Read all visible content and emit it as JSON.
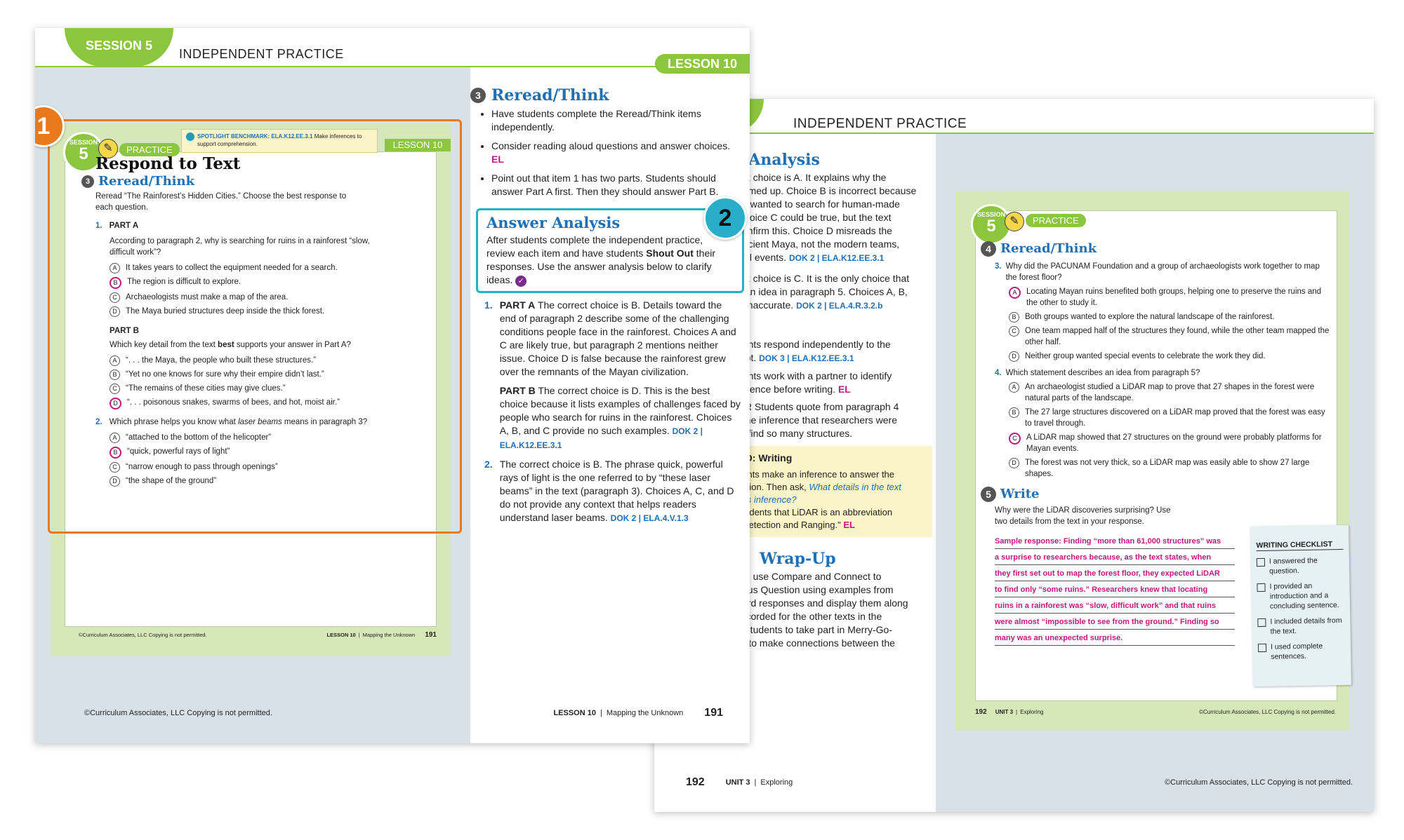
{
  "back": {
    "header": "INDEPENDENT PRACTICE",
    "session_partial": "N 5",
    "col1_heading_partial": "r Analysis",
    "col1_text": [
      {
        "t": "ect choice is A. It explains why the"
      },
      {
        "t": "eamed up. Choice B is incorrect because"
      },
      {
        "t": "ps wanted to search for human-made"
      },
      {
        "t": "Choice C could be true, but the text"
      },
      {
        "t": "confirm this. Choice D misreads the"
      },
      {
        "t": "ancient Maya, not the modern teams,"
      },
      {
        "t": "cial events."
      }
    ],
    "col1_dok1": "DOK 2 | ELA.K12.EE.3.1",
    "col1_text2": [
      "ect choice is C. It is the only choice that",
      "s an idea in paragraph 5. Choices A, B,",
      "e inaccurate."
    ],
    "col1_dok2": "DOK 2 | ELA.4.R.3.2.b",
    "col1_text3": [
      "dents respond independently to the",
      "mpt."
    ],
    "col1_dok3": "DOK 3 | ELA.K12.EE.3.1",
    "col1_text4": [
      "dents work with a partner to identify",
      "vidence before writing."
    ],
    "col1_el": "EL",
    "col1_text5": [
      "OR  Students quote from paragraph 4",
      "t the inference that researchers were",
      "to find so many structures."
    ],
    "go_box": {
      "title": "GO: Writing",
      "lines": [
        "dents make an inference to answer the",
        "estion. Then ask,"
      ],
      "ask_italic": "What details in the text",
      "ask_italic2": "this inference?",
      "line3": "students that LiDAR is an abbreviation",
      "line4": "t Detection and Ranging.\"",
      "el": "EL"
    },
    "wrapup_heading": "Wrap-Up",
    "wrapup_text": [
      "nts use Compare and Connect to",
      "ocus Question using examples from",
      "cord responses and display them along",
      "recorded for the other texts in the",
      "e students to take part in Merry-Go-",
      "re to make connections between the"
    ],
    "footer_page": "192",
    "footer_unit": "UNIT 3",
    "footer_unit_title": "Exploring",
    "footer_copy": "©Curriculum Associates, LLC   Copying is not permitted.",
    "inset": {
      "session_label": "SESSION",
      "session_num": "5",
      "practice": "PRACTICE",
      "q4_heading": "Reread/Think",
      "q4_num": "4",
      "q3_num": "3.",
      "q3_text": "Why did the PACUNAM Foundation and a group of archaeologists work together to map the forest floor?",
      "q3_choices": [
        {
          "letter": "A",
          "text": "Locating Mayan ruins benefited both groups, helping one to preserve the ruins and the other to study it.",
          "sel": true
        },
        {
          "letter": "B",
          "text": "Both groups wanted to explore the natural landscape of the rainforest.",
          "sel": false
        },
        {
          "letter": "C",
          "text": "One team mapped half of the structures they found, while the other team mapped the other half.",
          "sel": false
        },
        {
          "letter": "D",
          "text": "Neither group wanted special events to celebrate the work they did.",
          "sel": false
        }
      ],
      "q4q_num": "4.",
      "q4_text": "Which statement describes an idea from paragraph 5?",
      "q4_choices": [
        {
          "letter": "A",
          "text": "An archaeologist studied a LiDAR map to prove that 27 shapes in the forest were natural parts of the landscape.",
          "sel": false
        },
        {
          "letter": "B",
          "text": "The 27 large structures discovered on a LiDAR map proved that the forest was easy to travel through.",
          "sel": false
        },
        {
          "letter": "C",
          "text": "A LiDAR map showed that 27 structures on the ground were probably platforms for Mayan events.",
          "sel": true
        },
        {
          "letter": "D",
          "text": "The forest was not very thick, so a LiDAR map was easily able to show 27 large shapes.",
          "sel": false
        }
      ],
      "write_num": "5",
      "write_heading": "Write",
      "write_prompt": "Why were the LiDAR discoveries surprising? Use two details from the text in your response.",
      "sample_lines": [
        "Sample response: Finding “more than 61,000 structures” was",
        "a surprise to researchers because, as the text states, when",
        "they first set out to map the forest floor, they expected LiDAR",
        "to find only “some ruins.” Researchers knew that locating",
        "ruins in a rainforest was “slow, difficult work” and that ruins",
        "were almost “impossible to see from the ground.” Finding so",
        "many was an unexpected surprise."
      ],
      "checklist_title": "WRITING CHECKLIST",
      "checklist": [
        "I answered the question.",
        "I provided an introduction and a concluding sentence.",
        "I included details from the text.",
        "I used complete sentences."
      ],
      "footer_page": "192",
      "footer_unit": "UNIT 3",
      "footer_unit_title": "Exploring",
      "footer_copy": "©Curriculum Associates, LLC   Copying is not permitted."
    }
  },
  "front": {
    "session_tab": "SESSION 5",
    "header": "INDEPENDENT PRACTICE",
    "lesson_tab": "LESSON 10",
    "callout1": "1",
    "callout2": "2",
    "inset": {
      "session_label": "SESSION",
      "session_num": "5",
      "practice": "PRACTICE",
      "benchmark_label": "SPOTLIGHT BENCHMARK: ELA.K12.EE.3.1",
      "benchmark_text": "Make inferences to support comprehension.",
      "lesson": "LESSON 10",
      "title": "Respond to Text",
      "heading_num": "3",
      "heading": "Reread/Think",
      "intro": "Reread “The Rainforest’s Hidden Cities.” Choose the best response to each question.",
      "q1_num": "1.",
      "partA": "PART A",
      "partA_text": "According to paragraph 2, why is searching for ruins in a rainforest “slow, difficult work”?",
      "partA_choices": [
        {
          "letter": "A",
          "text": "It takes years to collect the equipment needed for a search.",
          "sel": false
        },
        {
          "letter": "B",
          "text": "The region is difficult to explore.",
          "sel": true
        },
        {
          "letter": "C",
          "text": "Archaeologists must make a map of the area.",
          "sel": false
        },
        {
          "letter": "D",
          "text": "The Maya buried structures deep inside the thick forest.",
          "sel": false
        }
      ],
      "partB": "PART B",
      "partB_text_pre": "Which key detail from the text ",
      "partB_text_bold": "best",
      "partB_text_post": " supports your answer in Part A?",
      "partB_choices": [
        {
          "letter": "A",
          "text": "“. . . the Maya, the people who built these structures.”",
          "sel": false
        },
        {
          "letter": "B",
          "text": "“Yet no one knows for sure why their empire didn’t last.”",
          "sel": false
        },
        {
          "letter": "C",
          "text": "“The remains of these cities may give clues.”",
          "sel": false
        },
        {
          "letter": "D",
          "text": "“. . . poisonous snakes, swarms of bees, and hot, moist air.”",
          "sel": true
        }
      ],
      "q2_num": "2.",
      "q2_pre": "Which phrase helps you know what ",
      "q2_italic": "laser beams",
      "q2_post": " means in paragraph 3?",
      "q2_choices": [
        {
          "letter": "A",
          "text": "“attached to the bottom of the helicopter”",
          "sel": false
        },
        {
          "letter": "B",
          "text": "“quick, powerful rays of light”",
          "sel": true
        },
        {
          "letter": "C",
          "text": "“narrow enough to pass through openings”",
          "sel": false
        },
        {
          "letter": "D",
          "text": "“the shape of the ground”",
          "sel": false
        }
      ],
      "footer_copy": "©Curriculum Associates, LLC   Copying is not permitted.",
      "footer_lesson": "LESSON 10",
      "footer_title": "Mapping the Unknown",
      "footer_page": "191"
    },
    "right": {
      "rt_num": "3",
      "rt_heading": "Reread/Think",
      "bullets": [
        "Have students complete the Reread/Think items independently.",
        "Consider reading aloud questions and answer choices.",
        "Point out that item 1 has two parts. Students should answer Part A first. Then they should answer Part B."
      ],
      "el": "EL",
      "aa_heading": "Answer Analysis",
      "aa_pre": "After students complete the independent practice, review each item and have students ",
      "aa_bold": "Shout Out",
      "aa_post": " their responses. Use the answer analysis below to clarify ideas.",
      "a1_num": "1.",
      "a1_partA": "PART A",
      "a1_partA_text": "The correct choice is B. Details toward the end of paragraph 2 describe some of the challenging conditions people face in the rainforest. Choices A and C are likely true, but paragraph 2 mentions neither issue. Choice D is false because the rainforest grew over the remnants of the Mayan civilization.",
      "a1_partB": "PART B",
      "a1_partB_text": "The correct choice is D. This is the best choice because it lists examples of challenges faced by people who search for ruins in the rainforest. Choices A, B, and C provide no such examples.",
      "a1_dok": "DOK 2 | ELA.K12.EE.3.1",
      "a2_num": "2.",
      "a2_text": "The correct choice is B. The phrase quick, powerful rays of light is the one referred to by “these laser beams” in the text (paragraph 3). Choices A, C, and D do not provide any context that helps readers understand laser beams.",
      "a2_dok": "DOK 2 | ELA.4.V.1.3"
    },
    "footer_copy": "©Curriculum Associates, LLC   Copying is not permitted.",
    "footer_lesson": "LESSON 10",
    "footer_title": "Mapping the Unknown",
    "footer_page": "191"
  }
}
